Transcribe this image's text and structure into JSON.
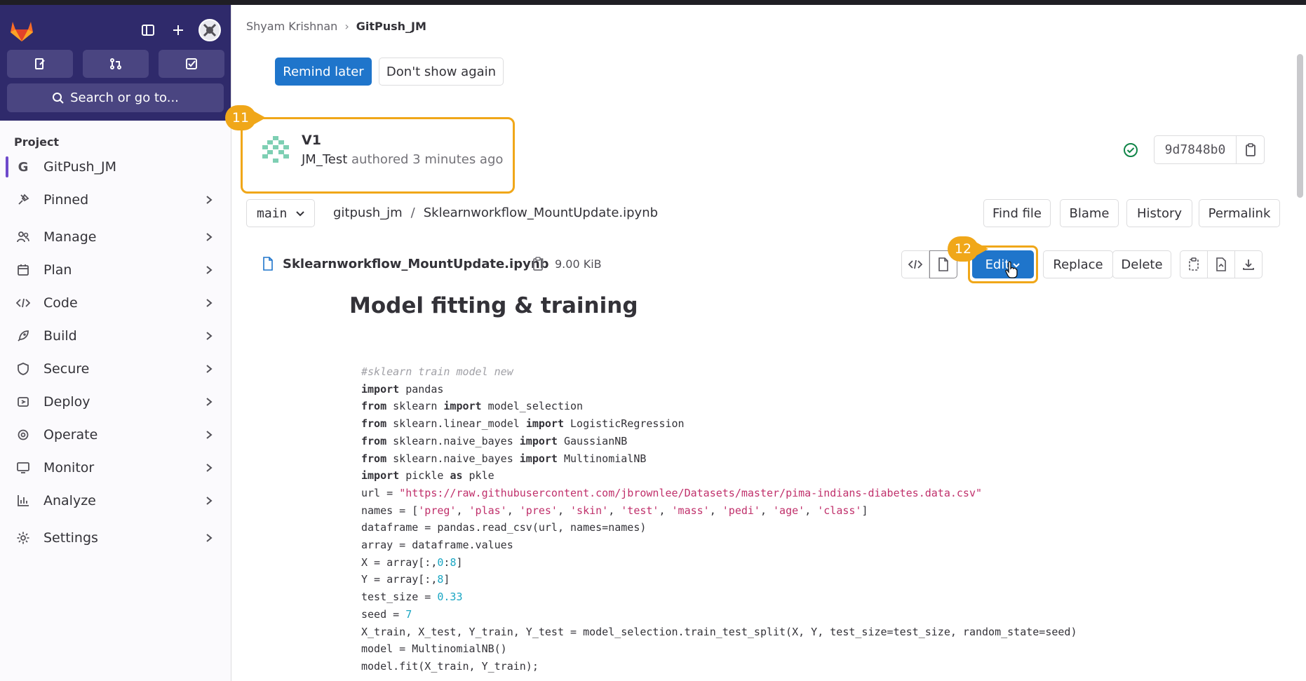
{
  "breadcrumb": {
    "owner": "Shyam Krishnan",
    "project": "GitPush_JM"
  },
  "banner": {
    "remind_label": "Remind later",
    "dismiss_label": "Don't show again"
  },
  "steps": {
    "commit": "11",
    "edit": "12"
  },
  "commit": {
    "title": "V1",
    "author": "JM_Test",
    "meta": "authored 3 minutes ago",
    "sha": "9d7848b0",
    "status": "success"
  },
  "sidebar": {
    "search_label": "Search or go to...",
    "section_label": "Project",
    "project_letter": "G",
    "items": [
      {
        "label": "GitPush_JM"
      },
      {
        "label": "Pinned"
      },
      {
        "label": "Manage"
      },
      {
        "label": "Plan"
      },
      {
        "label": "Code"
      },
      {
        "label": "Build"
      },
      {
        "label": "Secure"
      },
      {
        "label": "Deploy"
      },
      {
        "label": "Operate"
      },
      {
        "label": "Monitor"
      },
      {
        "label": "Analyze"
      },
      {
        "label": "Settings"
      }
    ]
  },
  "repo": {
    "branch": "main",
    "path_root": "gitpush_jm",
    "path_file": "Sklearnworkflow_MountUpdate.ipynb",
    "actions": {
      "find_file": "Find file",
      "blame": "Blame",
      "history": "History",
      "permalink": "Permalink"
    }
  },
  "file": {
    "name": "Sklearnworkflow_MountUpdate.ipynb",
    "size": "9.00 KiB",
    "edit_label": "Edit",
    "replace_label": "Replace",
    "delete_label": "Delete"
  },
  "notebook": {
    "heading": "Model fitting & training",
    "code": {
      "l0": "#sklearn train model new",
      "l1": [
        "import",
        " pandas"
      ],
      "l2": [
        "from",
        " sklearn ",
        "import",
        " model_selection"
      ],
      "l3": [
        "from",
        " sklearn.linear_model ",
        "import",
        " LogisticRegression"
      ],
      "l4": [
        "from",
        " sklearn.naive_bayes ",
        "import",
        " GaussianNB"
      ],
      "l5": [
        "from",
        " sklearn.naive_bayes ",
        "import",
        " MultinomialNB"
      ],
      "l6": [
        "import",
        " pickle ",
        "as",
        " pkle"
      ],
      "l7": [
        "url = ",
        "\"https://raw.githubusercontent.com/jbrownlee/Datasets/master/pima-indians-diabetes.data.csv\""
      ],
      "l8": [
        "names = [",
        "'preg'",
        ", ",
        "'plas'",
        ", ",
        "'pres'",
        ", ",
        "'skin'",
        ", ",
        "'test'",
        ", ",
        "'mass'",
        ", ",
        "'pedi'",
        ", ",
        "'age'",
        ", ",
        "'class'",
        "]"
      ],
      "l9": "dataframe = pandas.read_csv(url, names=names)",
      "l10": "array = dataframe.values",
      "l11": [
        "X = array[:,",
        "0",
        ":",
        "8",
        "]"
      ],
      "l12": [
        "Y = array[:,",
        "8",
        "]"
      ],
      "l13": [
        "test_size = ",
        "0.33"
      ],
      "l14": [
        "seed = ",
        "7"
      ],
      "l15": "X_train, X_test, Y_train, Y_test = model_selection.train_test_split(X, Y, test_size=test_size, random_state=seed)",
      "l16": "model = MultinomialNB()",
      "l17": "model.fit(X_train, Y_train);"
    }
  }
}
